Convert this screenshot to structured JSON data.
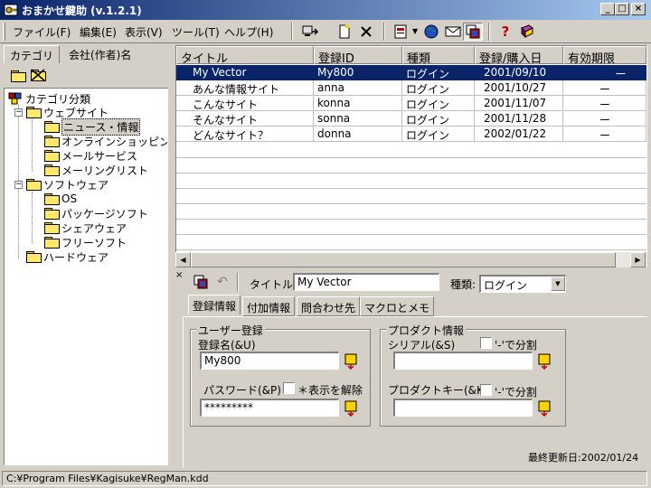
{
  "window": {
    "title": "おまかせ鍵助 (v.1.2.1)"
  },
  "menu": {
    "items": [
      "ファイル(F)",
      "編集(E)",
      "表示(V)",
      "ツール(T)",
      "ヘルプ(H)"
    ]
  },
  "left_panel": {
    "tabs": [
      "カテゴリ",
      "会社(作者)名"
    ],
    "tree": {
      "root": "カテゴリ分類",
      "web": "ウェブサイト",
      "web_children": [
        "ニュース・情報",
        "オンラインショッピング",
        "メールサービス",
        "メーリングリスト"
      ],
      "software": "ソフトウェア",
      "software_children": [
        "OS",
        "パッケージソフト",
        "シェアウェア",
        "フリーソフト"
      ],
      "hardware": "ハードウェア"
    }
  },
  "grid": {
    "columns": [
      "タイトル",
      "登録ID",
      "種類",
      "登録/購入日",
      "有効期限"
    ],
    "rows": [
      [
        "My Vector",
        "My800",
        "ログイン",
        "2001/09/10",
        "ー"
      ],
      [
        "あんな情報サイト",
        "anna",
        "ログイン",
        "2001/10/27",
        "ー"
      ],
      [
        "こんなサイト",
        "konna",
        "ログイン",
        "2001/11/07",
        "ー"
      ],
      [
        "そんなサイト",
        "sonna",
        "ログイン",
        "2001/11/28",
        "ー"
      ],
      [
        "どんなサイト？",
        "donna",
        "ログイン",
        "2002/01/22",
        "ー"
      ]
    ],
    "selected_row": 0
  },
  "detail": {
    "title_label": "タイトル:",
    "title_value": "My Vector",
    "type_label": "種類:",
    "type_value": "ログイン",
    "tabs": [
      "登録情報",
      "付加情報",
      "問合わせ先",
      "マクロとメモ"
    ],
    "user_group": {
      "title": "ユーザー登録",
      "name_label": "登録名(&U)",
      "name_value": "My800",
      "password_label": "パスワード(&P)",
      "password_value": "*********",
      "show_label": "＊表示を解除"
    },
    "product_group": {
      "title": "プロダクト情報",
      "serial_label": "シリアル(&S)",
      "serial_split": "'-'で分割",
      "serial_value": "",
      "key_label": "プロダクトキー(&K)",
      "key_split": "'-'で分割",
      "key_value": ""
    },
    "last_updated": "最終更新日:2002/01/24"
  },
  "status": {
    "path": "C:¥Program Files¥Kagisuke¥RegMan.kdd"
  },
  "colors": {
    "title_bar": "#0a246a",
    "selection": "#0a246a",
    "face": "#d4d0c8"
  }
}
